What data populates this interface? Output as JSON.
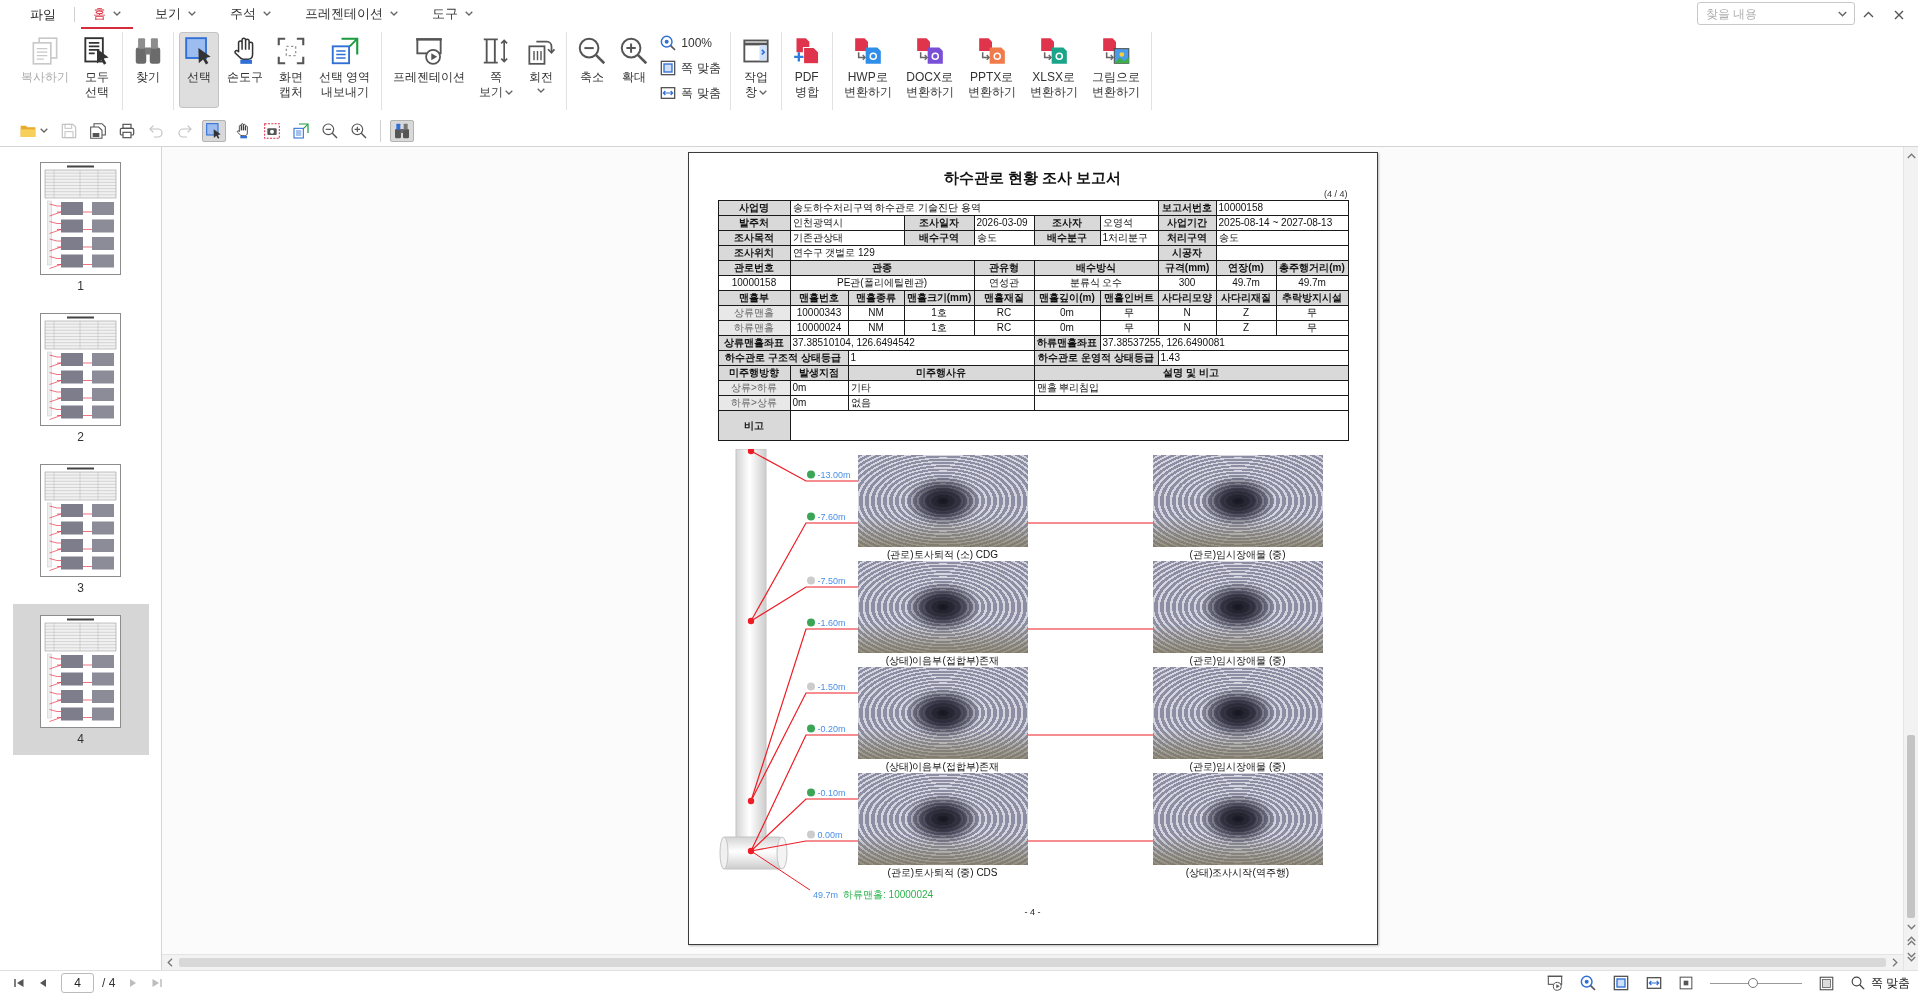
{
  "menu": {
    "file": "파일",
    "tabs": [
      {
        "label": "홈",
        "selected": true
      },
      {
        "label": "보기",
        "selected": false
      },
      {
        "label": "주석",
        "selected": false
      },
      {
        "label": "프레젠테이션",
        "selected": false
      },
      {
        "label": "도구",
        "selected": false
      }
    ]
  },
  "find": {
    "placeholder": "찾을 내용"
  },
  "ribbon": {
    "groups": [
      {
        "items": [
          {
            "kind": "large",
            "label": "복사하기",
            "selected": false,
            "disabled": true,
            "dropdown": false
          },
          {
            "kind": "large",
            "label": "모두\n선택",
            "selected": false,
            "disabled": false,
            "dropdown": false
          }
        ]
      },
      {
        "items": [
          {
            "kind": "large",
            "label": "찾기",
            "selected": false,
            "disabled": false,
            "dropdown": false
          }
        ]
      },
      {
        "items": [
          {
            "kind": "large",
            "label": "선택",
            "selected": true,
            "disabled": false,
            "dropdown": false
          },
          {
            "kind": "large",
            "label": "손도구",
            "selected": false,
            "disabled": false,
            "dropdown": false
          },
          {
            "kind": "large",
            "label": "화면\n캡처",
            "selected": false,
            "disabled": false,
            "dropdown": false
          },
          {
            "kind": "large",
            "label": "선택 영역\n내보내기",
            "selected": false,
            "disabled": false,
            "dropdown": false
          }
        ]
      },
      {
        "items": [
          {
            "kind": "large",
            "label": "프레젠테이션",
            "selected": false,
            "disabled": false,
            "dropdown": false
          },
          {
            "kind": "large",
            "label": "쪽\n보기",
            "selected": false,
            "disabled": false,
            "dropdown": true
          },
          {
            "kind": "large",
            "label": "회전",
            "selected": false,
            "disabled": false,
            "dropdown": true
          }
        ]
      },
      {
        "items": [
          {
            "kind": "large",
            "label": "축소",
            "selected": false,
            "disabled": false,
            "dropdown": false
          },
          {
            "kind": "large",
            "label": "확대",
            "selected": false,
            "disabled": false,
            "dropdown": false
          },
          {
            "kind": "small",
            "label": "100%",
            "selected": false,
            "disabled": false,
            "dropdown": false
          },
          {
            "kind": "small",
            "label": "쪽 맞춤",
            "selected": false,
            "disabled": false,
            "dropdown": false
          },
          {
            "kind": "small",
            "label": "폭 맞춤",
            "selected": false,
            "disabled": false,
            "dropdown": false
          }
        ]
      },
      {
        "items": [
          {
            "kind": "large",
            "label": "작업\n창",
            "selected": false,
            "disabled": false,
            "dropdown": true
          }
        ]
      },
      {
        "items": [
          {
            "kind": "large",
            "label": "PDF\n병합",
            "selected": false,
            "disabled": false,
            "dropdown": false
          }
        ]
      },
      {
        "items": [
          {
            "kind": "large",
            "label": "HWP로\n변환하기",
            "selected": false,
            "disabled": false,
            "dropdown": false
          },
          {
            "kind": "large",
            "label": "DOCX로\n변환하기",
            "selected": false,
            "disabled": false,
            "dropdown": false
          },
          {
            "kind": "large",
            "label": "PPTX로\n변환하기",
            "selected": false,
            "disabled": false,
            "dropdown": false
          },
          {
            "kind": "large",
            "label": "XLSX로\n변환하기",
            "selected": false,
            "disabled": false,
            "dropdown": false
          },
          {
            "kind": "large",
            "label": "그림으로\n변환하기",
            "selected": false,
            "disabled": false,
            "dropdown": false
          }
        ]
      }
    ]
  },
  "quick_toolbar": {
    "groups": [
      {
        "items": [
          {
            "selected": false,
            "disabled": false,
            "dropdown": true
          },
          {
            "selected": false,
            "disabled": true,
            "dropdown": false
          },
          {
            "selected": false,
            "disabled": false,
            "dropdown": false
          },
          {
            "selected": false,
            "disabled": false,
            "dropdown": false
          },
          {
            "selected": false,
            "disabled": true,
            "dropdown": false
          },
          {
            "selected": false,
            "disabled": true,
            "dropdown": false
          },
          {
            "selected": true,
            "disabled": false,
            "dropdown": false
          },
          {
            "selected": false,
            "disabled": false,
            "dropdown": false
          },
          {
            "selected": false,
            "disabled": false,
            "dropdown": false
          },
          {
            "selected": false,
            "disabled": false,
            "dropdown": false
          },
          {
            "selected": false,
            "disabled": false,
            "dropdown": false
          },
          {
            "selected": false,
            "disabled": false,
            "dropdown": false
          }
        ]
      },
      {
        "items": [
          {
            "selected": true,
            "disabled": false,
            "dropdown": false
          }
        ]
      }
    ]
  },
  "thumbnails": [
    {
      "label": "1",
      "selected": false
    },
    {
      "label": "2",
      "selected": false
    },
    {
      "label": "3",
      "selected": false
    },
    {
      "label": "4",
      "selected": true
    }
  ],
  "document": {
    "title": "하수관로 현황 조사 보고서",
    "page_count": "(4 / 4)",
    "table": {
      "rows": [
        [
          {
            "kind": "head",
            "text": "사업명"
          },
          {
            "kind": "value",
            "text": "송도하수처리구역 하수관로 기술진단 용역",
            "colspan": 6
          },
          {
            "kind": "head",
            "text": "보고서번호"
          },
          {
            "kind": "value",
            "text": "10000158",
            "colspan": 2
          }
        ],
        [
          {
            "kind": "head",
            "text": "발주처"
          },
          {
            "kind": "value",
            "text": "인천광역시",
            "colspan": 2
          },
          {
            "kind": "head",
            "text": "조사일자"
          },
          {
            "kind": "value",
            "text": "2026-03-09"
          },
          {
            "kind": "head",
            "text": "조사자"
          },
          {
            "kind": "value",
            "text": "오영석"
          },
          {
            "kind": "head",
            "text": "사업기간"
          },
          {
            "kind": "value",
            "text": "2025-08-14 ~ 2027-08-13",
            "colspan": 2
          }
        ],
        [
          {
            "kind": "head",
            "text": "조사목적"
          },
          {
            "kind": "value",
            "text": "기존관상태",
            "colspan": 2
          },
          {
            "kind": "head",
            "text": "배수구역"
          },
          {
            "kind": "value",
            "text": "송도"
          },
          {
            "kind": "head",
            "text": "배수분구"
          },
          {
            "kind": "value",
            "text": "1처리분구"
          },
          {
            "kind": "head",
            "text": "처리구역"
          },
          {
            "kind": "value",
            "text": "송도",
            "colspan": 2
          }
        ],
        [
          {
            "kind": "head",
            "text": "조사위치"
          },
          {
            "kind": "value",
            "text": "연수구 갯벌로 129",
            "colspan": 6
          },
          {
            "kind": "head",
            "text": "시공자"
          },
          {
            "kind": "value",
            "colspan": 2
          }
        ],
        [
          {
            "kind": "head",
            "text": "관로번호"
          },
          {
            "kind": "head",
            "text": "관종",
            "colspan": 3
          },
          {
            "kind": "head",
            "text": "관유형"
          },
          {
            "kind": "head",
            "text": "배수방식",
            "colspan": 2
          },
          {
            "kind": "head",
            "text": "규격(mm)"
          },
          {
            "kind": "head",
            "text": "연장(m)"
          },
          {
            "kind": "head",
            "text": "총주행거리(m)"
          }
        ],
        [
          {
            "kind": "value",
            "text": "10000158"
          },
          {
            "kind": "value",
            "text": "PE관(폴리에틸렌관)",
            "colspan": 3
          },
          {
            "kind": "value",
            "text": "연성관"
          },
          {
            "kind": "value",
            "text": "분류식 오수",
            "colspan": 2
          },
          {
            "kind": "value",
            "text": "300"
          },
          {
            "kind": "value",
            "text": "49.7m"
          },
          {
            "kind": "value",
            "text": "49.7m"
          }
        ],
        [
          {
            "kind": "head",
            "text": "맨홀부"
          },
          {
            "kind": "head",
            "text": "맨홀번호"
          },
          {
            "kind": "head",
            "text": "맨홀종류"
          },
          {
            "kind": "head",
            "text": "맨홀크기(mm)"
          },
          {
            "kind": "head",
            "text": "맨홀재질"
          },
          {
            "kind": "head",
            "text": "맨홀깊이(m)"
          },
          {
            "kind": "head",
            "text": "맨홀인버트"
          },
          {
            "kind": "head",
            "text": "사다리모양"
          },
          {
            "kind": "head",
            "text": "사다리재질"
          },
          {
            "kind": "head",
            "text": "추락방지시설"
          }
        ],
        [
          {
            "kind": "label",
            "text": "상류맨홀"
          },
          {
            "kind": "value",
            "text": "10000343"
          },
          {
            "kind": "value",
            "text": "NM"
          },
          {
            "kind": "value",
            "text": "1호"
          },
          {
            "kind": "value",
            "text": "RC"
          },
          {
            "kind": "value",
            "text": "0m"
          },
          {
            "kind": "value",
            "text": "무"
          },
          {
            "kind": "value",
            "text": "N"
          },
          {
            "kind": "value",
            "text": "Z"
          },
          {
            "kind": "value",
            "text": "무"
          }
        ],
        [
          {
            "kind": "label",
            "text": "하류맨홀"
          },
          {
            "kind": "value",
            "text": "10000024"
          },
          {
            "kind": "value",
            "text": "NM"
          },
          {
            "kind": "value",
            "text": "1호"
          },
          {
            "kind": "value",
            "text": "RC"
          },
          {
            "kind": "value",
            "text": "0m"
          },
          {
            "kind": "value",
            "text": "무"
          },
          {
            "kind": "value",
            "text": "N"
          },
          {
            "kind": "value",
            "text": "Z"
          },
          {
            "kind": "value",
            "text": "무"
          }
        ],
        [
          {
            "kind": "head",
            "text": "상류맨홀좌표"
          },
          {
            "kind": "value",
            "text": "37.38510104, 126.6494542",
            "colspan": 4
          },
          {
            "kind": "head",
            "text": "하류맨홀좌표"
          },
          {
            "kind": "value",
            "text": "37.38537255, 126.6490081",
            "colspan": 4
          }
        ],
        [
          {
            "kind": "head",
            "text": "하수관로 구조적 상태등급",
            "colspan": 2
          },
          {
            "kind": "value",
            "text": "1",
            "colspan": 3
          },
          {
            "kind": "head",
            "text": "하수관로 운영적 상태등급",
            "colspan": 2
          },
          {
            "kind": "value",
            "text": "1.43",
            "colspan": 3
          }
        ],
        [
          {
            "kind": "head",
            "text": "미주행방향"
          },
          {
            "kind": "head",
            "text": "발생지점"
          },
          {
            "kind": "head",
            "text": "미주행사유",
            "colspan": 3
          },
          {
            "kind": "head",
            "text": "설명 및 비고",
            "colspan": 5
          }
        ],
        [
          {
            "kind": "label",
            "text": "상류>하류"
          },
          {
            "kind": "value",
            "text": "0m"
          },
          {
            "kind": "value",
            "text": "기타",
            "colspan": 3
          },
          {
            "kind": "value",
            "text": "맨홀 뿌리침입",
            "colspan": 5
          }
        ],
        [
          {
            "kind": "label",
            "text": "하류>상류"
          },
          {
            "kind": "value",
            "text": "0m"
          },
          {
            "kind": "value",
            "text": "없음",
            "colspan": 3
          },
          {
            "kind": "value",
            "colspan": 5
          }
        ],
        [
          {
            "kind": "head",
            "text": "비고"
          },
          {
            "kind": "value",
            "colspan": 9
          }
        ]
      ]
    },
    "photo_rows": [
      {
        "markers": [
          {
            "depth": "-13.00m",
            "color": "#3aa655"
          },
          {
            "depth": "-7.60m",
            "color": "#3aa655"
          }
        ],
        "photos": [
          {
            "caption": "(관로)토사퇴적 (소) CDG"
          },
          {
            "caption": "(관로)임시장애물 (중)"
          }
        ]
      },
      {
        "markers": [
          {
            "depth": "-7.50m",
            "color": "#cccccc"
          },
          {
            "depth": "-1.60m",
            "color": "#3aa655"
          }
        ],
        "photos": [
          {
            "caption": "(상태)이음부(접합부)존재"
          },
          {
            "caption": "(관로)임시장애물 (중)"
          }
        ]
      },
      {
        "markers": [
          {
            "depth": "-1.50m",
            "color": "#cccccc"
          },
          {
            "depth": "-0.20m",
            "color": "#3aa655"
          }
        ],
        "photos": [
          {
            "caption": "(상태)이음부(접합부)존재"
          },
          {
            "caption": "(관로)임시장애물 (중)"
          }
        ]
      },
      {
        "markers": [
          {
            "depth": "-0.10m",
            "color": "#3aa655"
          },
          {
            "depth": "0.00m",
            "color": "#cccccc"
          }
        ],
        "photos": [
          {
            "caption": "(관로)토사퇴적 (중) CDS"
          },
          {
            "caption": "(상태)조사시작(역주행)"
          }
        ]
      }
    ],
    "pipe_end": {
      "distance": "49.7m",
      "label": "하류맨홀: 10000024"
    },
    "page_number": "- 4 -"
  },
  "status_bar": {
    "nav": [
      {
        "disabled": false
      },
      {
        "disabled": false
      },
      {
        "disabled": true
      },
      {
        "disabled": true
      }
    ],
    "page": "4",
    "total": "/ 4",
    "zoom_slider": {
      "level": 0.47
    },
    "zoom_mode": "쪽 맞춤"
  }
}
